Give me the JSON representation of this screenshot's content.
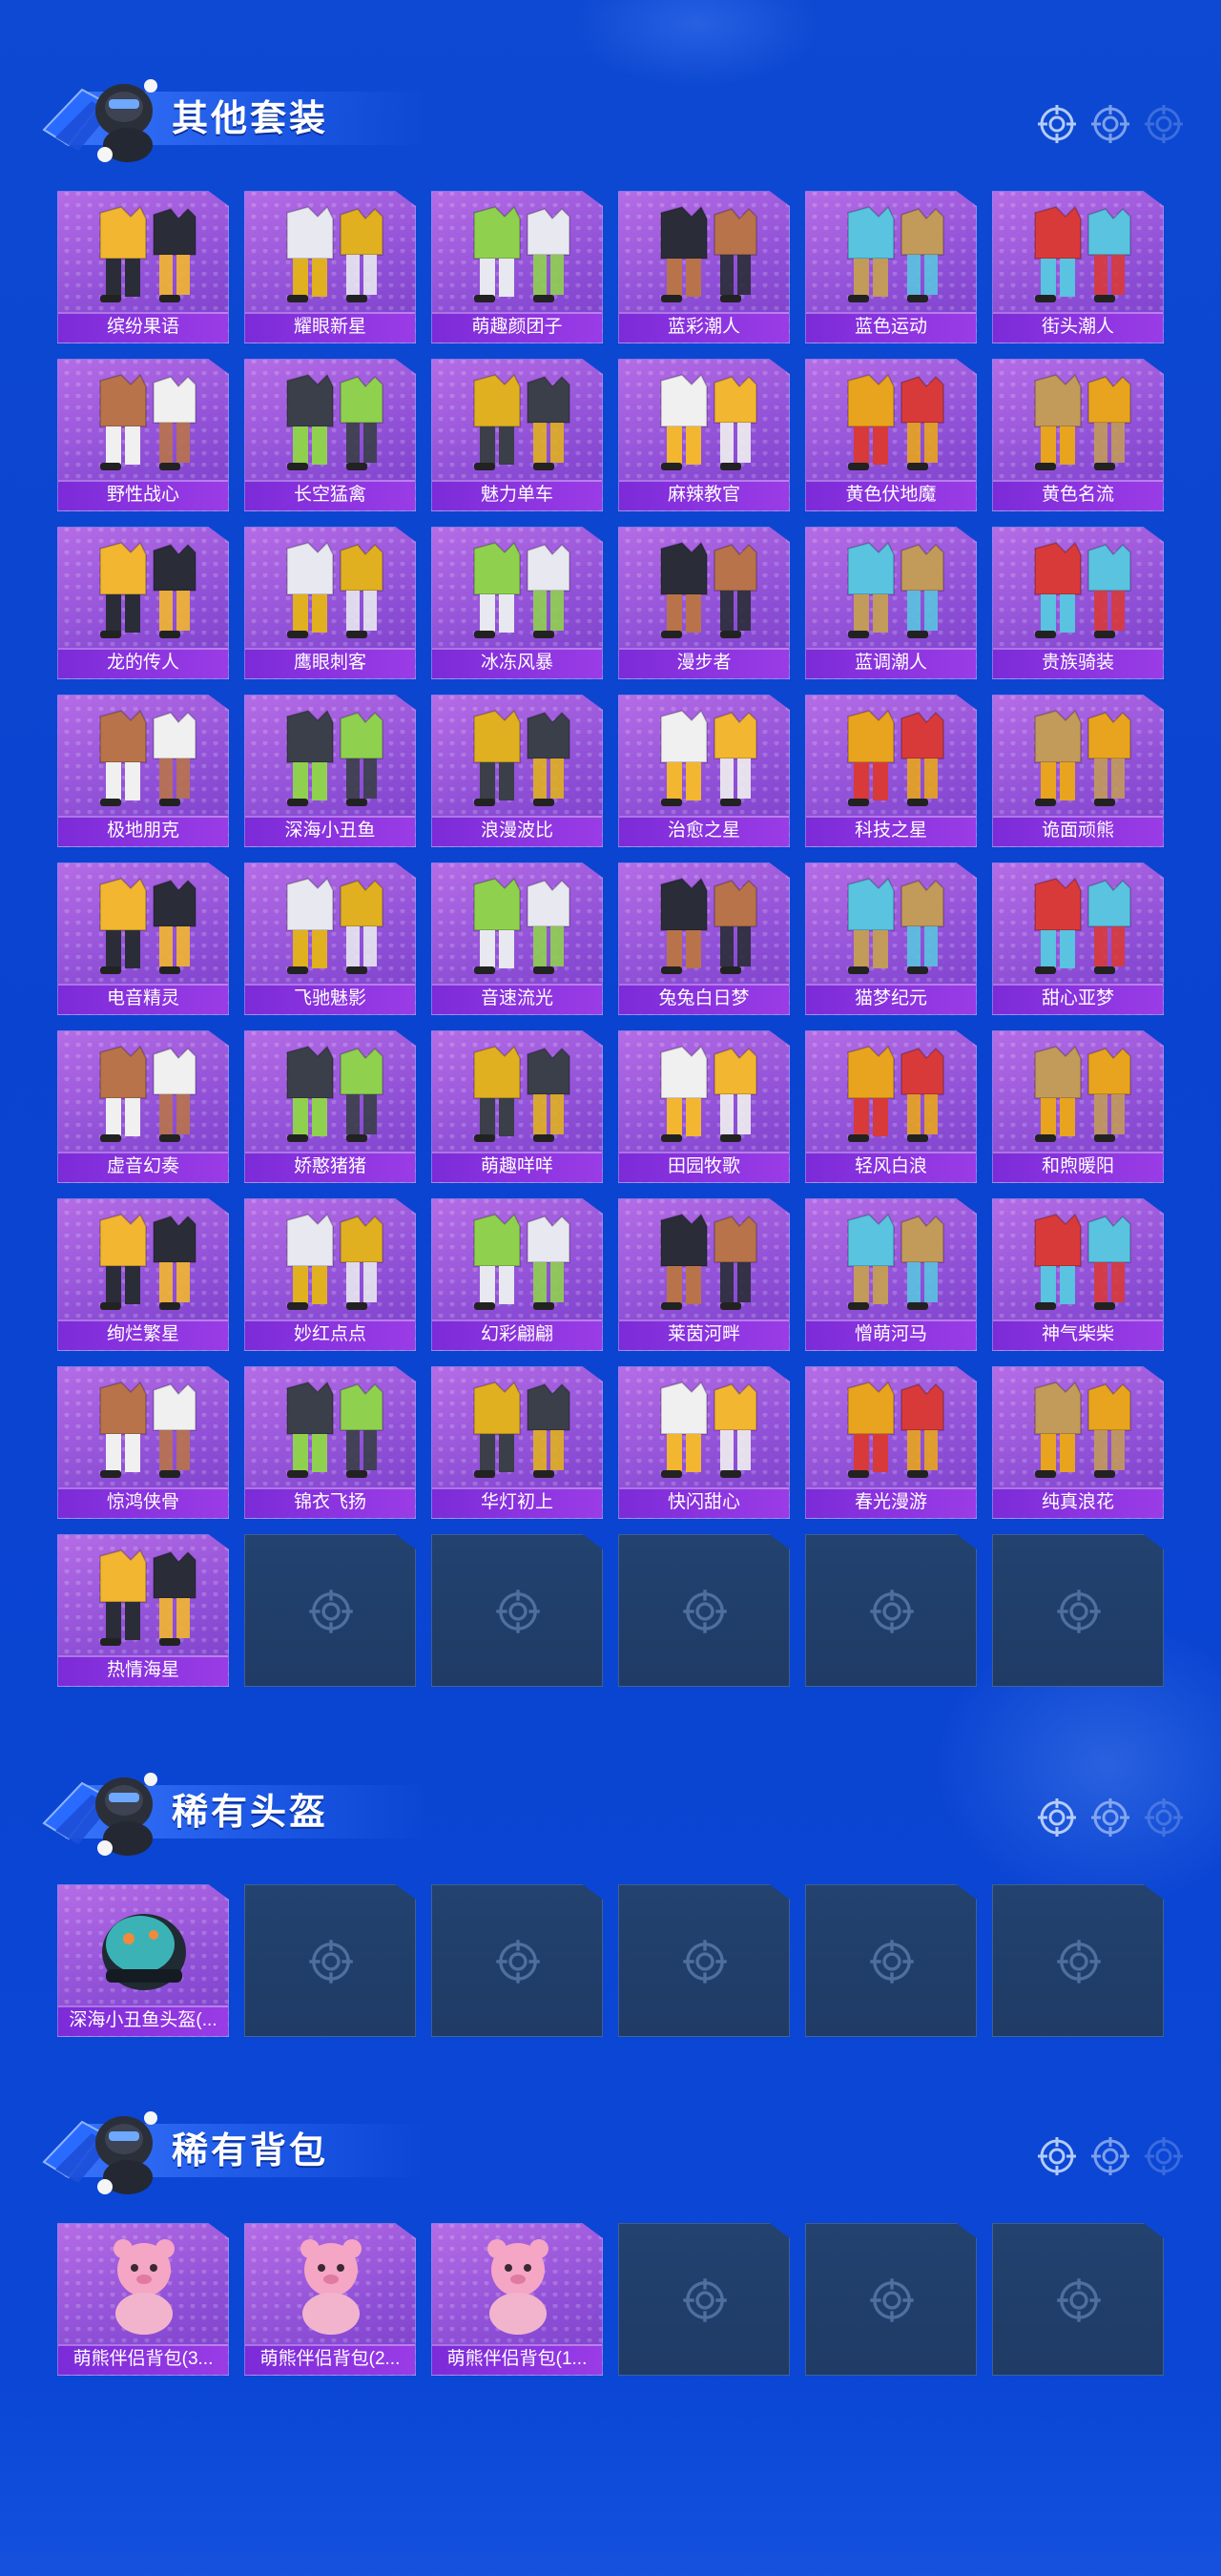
{
  "colors": {
    "background": "#0a43cf",
    "card_purple": "#8e4fd6",
    "label_purple": "#7c2bd8",
    "empty_slot": "#213f6b"
  },
  "sections": [
    {
      "title": "其他套装",
      "icon": "mascot-icon",
      "items": [
        "缤纷果语",
        "耀眼新星",
        "萌趣颜团子",
        "蓝彩潮人",
        "蓝色运动",
        "街头潮人",
        "野性战心",
        "长空猛禽",
        "魅力单车",
        "麻辣教官",
        "黄色伏地魔",
        "黄色名流",
        "龙的传人",
        "鹰眼刺客",
        "冰冻风暴",
        "漫步者",
        "蓝调潮人",
        "贵族骑装",
        "极地朋克",
        "深海小丑鱼",
        "浪漫波比",
        "治愈之星",
        "科技之星",
        "诡面顽熊",
        "电音精灵",
        "飞驰魅影",
        "音速流光",
        "兔兔白日梦",
        "猫梦纪元",
        "甜心亚梦",
        "虚音幻奏",
        "娇憨猪猪",
        "萌趣咩咩",
        "田园牧歌",
        "轻风白浪",
        "和煦暖阳",
        "绚烂繁星",
        "妙红点点",
        "幻彩翩翩",
        "莱茵河畔",
        "憎萌河马",
        "神气柴柴",
        "惊鸿侠骨",
        "锦衣飞扬",
        "华灯初上",
        "快闪甜心",
        "春光漫游",
        "纯真浪花",
        "热情海星"
      ],
      "empty_slots": 5
    },
    {
      "title": "稀有头盔",
      "icon": "mascot-icon",
      "items": [
        "深海小丑鱼头盔(..."
      ],
      "empty_slots": 5
    },
    {
      "title": "稀有背包",
      "icon": "mascot-icon",
      "items": [
        "萌熊伴侣背包(3...",
        "萌熊伴侣背包(2...",
        "萌熊伴侣背包(1..."
      ],
      "empty_slots": 3
    }
  ]
}
